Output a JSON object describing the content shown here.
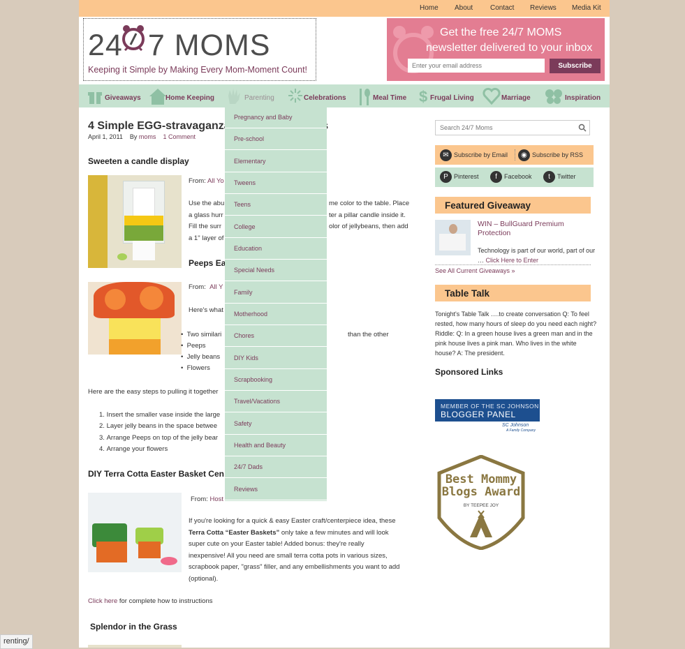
{
  "top_nav": [
    "Home",
    "About",
    "Contact",
    "Reviews",
    "Media Kit"
  ],
  "logo": {
    "left": "24",
    "right": "7 MOMS",
    "tagline": "Keeping it Simple by Making Every Mom-Moment Count!"
  },
  "newsletter": {
    "line1": "Get the free 24/7 MOMS",
    "line2": "newsletter delivered to your inbox",
    "placeholder": "Enter your email address",
    "button": "Subscribe"
  },
  "main_nav": [
    {
      "label": "Giveaways",
      "icon": "gift-icon"
    },
    {
      "label": "Home Keeping",
      "icon": "house-icon"
    },
    {
      "label": "Parenting",
      "icon": "hand-icon"
    },
    {
      "label": "Celebrations",
      "icon": "fireworks-icon"
    },
    {
      "label": "Meal Time",
      "icon": "utensils-icon"
    },
    {
      "label": "Frugal Living",
      "icon": "dollar-icon"
    },
    {
      "label": "Marriage",
      "icon": "heart-icon"
    },
    {
      "label": "Inspiration",
      "icon": "butterfly-icon"
    }
  ],
  "dropdown": [
    "Pregnancy and Baby",
    "Pre-school",
    "Elementary",
    "Tweens",
    "Teens",
    "College",
    "Education",
    "Special Needs",
    "Family",
    "Motherhood",
    "Chores",
    "DIY Kids",
    "Scrapbooking",
    "Travel/Vacations",
    "Safety",
    "Health and Beauty",
    "24/7 Dads",
    "Reviews"
  ],
  "post": {
    "title": "4 Simple EGG-stravaganzas",
    "title_end": "eces",
    "date": "April 1, 2011",
    "by": "By",
    "author": "moms",
    "comments": "1 Comment",
    "s1_heading": "Sweeten a candle display",
    "s1_from": "From:",
    "s1_from_link": "All Yo",
    "s1_p1a": "Use the abu",
    "s1_p1b": "me color to the table. Place",
    "s1_p2a": "a glass hurr",
    "s1_p2b": "ter a pillar candle inside it.",
    "s1_p3a": "Fill the surr",
    "s1_p3b": "olor of jellybeans, then add",
    "s1_p4a": "a 1\" layer of",
    "s2_heading": "Peeps Ea",
    "s2_from": "From:",
    "s2_from_link": "All Y",
    "s2_heres": "Here's what",
    "bullets": [
      "Two similari",
      "Peeps",
      "Jelly beans",
      "Flowers"
    ],
    "bullet1_end": "than the other",
    "steps_intro": "Here are the easy steps to pulling it together",
    "steps": [
      "Insert the smaller vase inside the large",
      "Layer jelly beans in the space betwee",
      "Arrange Peeps on top of the jelly bear",
      "Arrange your flowers"
    ],
    "s3_heading": "DIY Terra Cotta Easter Basket Cen",
    "s3_from": "From:",
    "s3_from_link": "Host",
    "s3_p_l1": "If you're looking for a quick & easy Easter craft/centerpiece idea, these",
    "s3_p_bold": "Terra Cotta “Easter Baskets”",
    "s3_p_l2": " only take a few minutes and will look",
    "s3_p_l3": "super cute on your Easter table! Added bonus: they're really",
    "s3_p_l4": "inexpensive! All you need are small terra cotta pots in various sizes,",
    "s3_p_l5": "scrapbook paper, \"grass\" filler, and any embellishments you want to add",
    "s3_p_l6": "(optional).",
    "click_here": "Click here",
    "click_rest": " for complete how to instructions",
    "s4_heading": "Splendor in the Grass"
  },
  "sidebar": {
    "search_placeholder": "Search 24/7 Moms",
    "sub_email": "Subscribe by Email",
    "sub_rss": "Subscribe by RSS",
    "pinterest": "Pinterest",
    "facebook": "Facebook",
    "twitter": "Twitter",
    "featured_heading": "Featured Giveaway",
    "giveaway_title1": "WIN – BullGuard Premium",
    "giveaway_title2": "Protection",
    "giveaway_text1": "Technology is part of our world, part of our",
    "giveaway_text2": "… ",
    "giveaway_link": "Click Here to Enter",
    "see_all": "See All Current Giveaways »",
    "tabletalk_heading": "Table Talk",
    "tabletalk_l1": "Tonight's Table Talk ….to create conversation Q: To feel",
    "tabletalk_l2": "rested, how many hours of sleep do you need each night?",
    "tabletalk_l3": "Riddle: Q: In a green house lives a green man and in the",
    "tabletalk_l4": "pink house lives a pink man. Who lives in the white",
    "tabletalk_l5": "house? A: The president.",
    "sponsored": "Sponsored Links",
    "sc_line1": "MEMBER OF THE SC JOHNSON",
    "sc_line2": "BLOGGER PANEL",
    "sc_brand": "SC Johnson",
    "sc_tag": "A Family Company",
    "badge_line1": "Best Mommy",
    "badge_line2": "Blogs Award",
    "badge_by": "BY TEEPEE JOY"
  },
  "status_url": "renting/",
  "colors": {
    "peach": "#fbc68e",
    "mint": "#c6e2d0",
    "plum": "#7b3b5a",
    "pink": "#e37d92",
    "bg": "#d8cbbb"
  }
}
